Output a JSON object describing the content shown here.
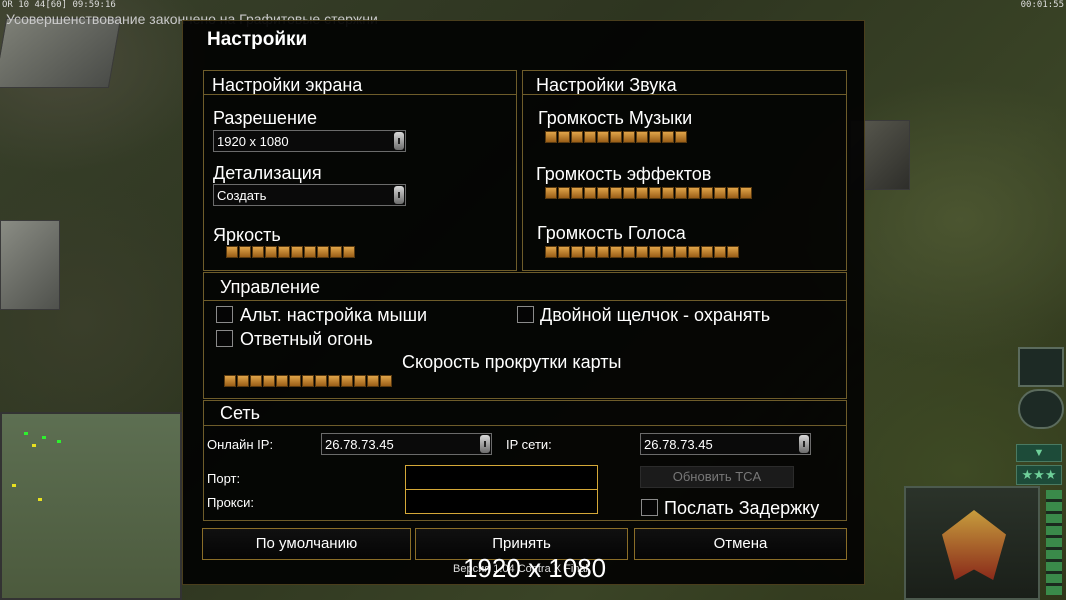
{
  "status_bar": {
    "left": "OR 10 44[60] 09:59:16",
    "right": "00:01:55"
  },
  "notification": "Усовершенствование закончено на Графитовые стержни",
  "dialog": {
    "title": "Настройки",
    "screen": {
      "title": "Настройки экрана",
      "resolution_label": "Разрешение",
      "resolution_value": "1920 x 1080",
      "detail_label": "Детализация",
      "detail_value": "Создать",
      "brightness_label": "Яркость",
      "brightness_level": 10,
      "brightness_segments": 10
    },
    "sound": {
      "title": "Настройки Звука",
      "music_label": "Громкость Музыки",
      "music_level": 11,
      "effects_label": "Громкость эффектов",
      "effects_level": 16,
      "voice_label": "Громкость Голоса",
      "voice_level": 15
    },
    "controls": {
      "title": "Управление",
      "alt_mouse": "Альт. настройка мыши",
      "double_click": "Двойной щелчок - охранять",
      "return_fire": "Ответный огонь",
      "scroll_speed_label": "Скорость прокрутки карты",
      "scroll_speed_level": 13
    },
    "network": {
      "title": "Сеть",
      "online_ip_label": "Онлайн IP:",
      "online_ip_value": "26.78.73.45",
      "lan_ip_label": "IP сети:",
      "lan_ip_value": "26.78.73.45",
      "port_label": "Порт:",
      "proxy_label": "Прокси:",
      "update_tca": "Обновить TCA",
      "send_delay": "Послать Задержку"
    },
    "buttons": {
      "default": "По умолчанию",
      "accept": "Принять",
      "cancel": "Отмена"
    }
  },
  "overlay": "1920 x 1080",
  "version": "Версия 1.04 Contra X Final"
}
